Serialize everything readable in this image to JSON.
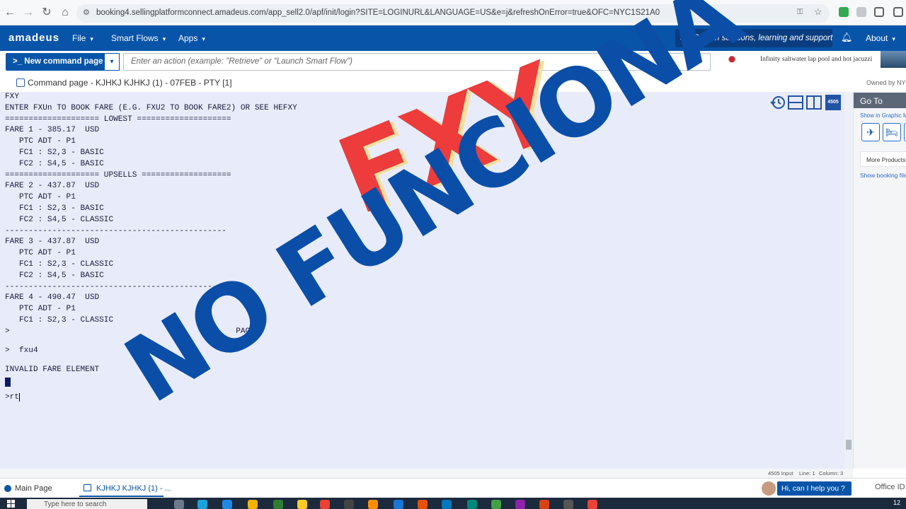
{
  "browser": {
    "url": "booking4.sellingplatformconnect.amadeus.com/app_sell2.0/apf/init/login?SITE=LOGINURL&LANGUAGE=US&e=j&refreshOnError=true&OFC=NYC1S21A0"
  },
  "nav": {
    "logo": "amadeus",
    "items": [
      {
        "label": "File"
      },
      {
        "label": "Smart Flows"
      },
      {
        "label": "Apps"
      }
    ],
    "search_placeholder": "Search solutions, learning and support",
    "about": "About"
  },
  "toolbar": {
    "new_command": ">_ New command page",
    "action_placeholder": "Enter an action (example: \"Retrieve\" or \"Launch Smart Flow\")",
    "ad_text": "Infinity saltwater lap pool and hot jacuzzi"
  },
  "tab": {
    "title": "Command page - KJHKJ KJHKJ (1) - 07FEB - PTY [1]",
    "owned_by": "Owned by NYC"
  },
  "command": {
    "lines": [
      "FXY",
      "ENTER FXUn TO BOOK FARE (E.G. FXU2 TO BOOK FARE2) OR SEE HEFXY",
      "==================== LOWEST ====================",
      "FARE 1 - 385.17  USD",
      "   PTC ADT - P1",
      "   FC1 : S2,3 - BASIC",
      "   FC2 : S4,5 - BASIC",
      "==================== UPSELLS ===================",
      "FARE 2 - 437.87  USD",
      "   PTC ADT - P1",
      "   FC1 : S2,3 - BASIC",
      "   FC2 : S4,5 - CLASSIC",
      "-----------------------------------------------",
      "FARE 3 - 437.87  USD",
      "   PTC ADT - P1",
      "   FC1 : S2,3 - CLASSIC",
      "   FC2 : S4,5 - BASIC",
      "-----------------------------------------------",
      "FARE 4 - 490.47  USD",
      "   PTC ADT - P1",
      "   FC1 : S2,3 - CLASSIC",
      ">                                                PAGE"
    ],
    "entry_1": ">  fxu4",
    "response_1": "INVALID FARE ELEMENT",
    "prompt_2": ">",
    "entry_2": "rt"
  },
  "overlay": {
    "line1": "FXY",
    "line2": "NO FUNCIONA"
  },
  "goto": {
    "header": "Go To",
    "show_graphic": "Show in Graphic M",
    "more_products": "More Products",
    "show_booking": "Show booking file"
  },
  "view_icons": {
    "badge": "4505"
  },
  "status": {
    "input": "4505 Input",
    "line": "Line: 1",
    "column": "Column: 3"
  },
  "bottom_tabs": {
    "main": "Main Page",
    "session": "KJHKJ KJHKJ (1) - ..."
  },
  "help": {
    "label": "Hi, can I help you ?",
    "office": "Office ID:"
  },
  "taskbar": {
    "search": "Type here to search",
    "clock": "12"
  }
}
